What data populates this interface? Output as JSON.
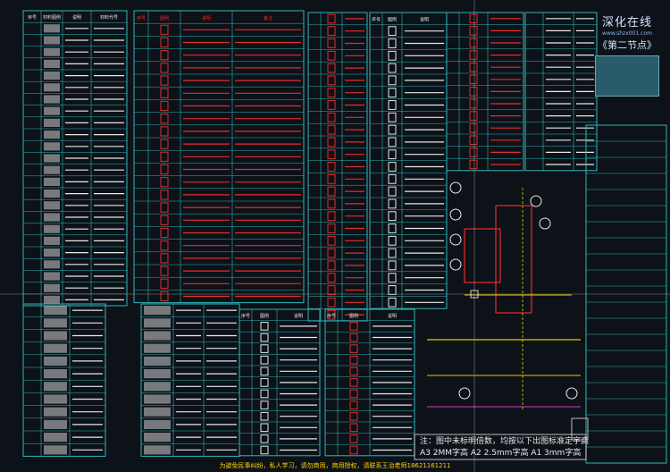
{
  "watermark": {
    "title": "深化在线",
    "url": "www.shzx001.com",
    "subtitle": "《第二节点》"
  },
  "note": {
    "line1": "注：图中未标明倍数，均按以下出图标准定字高",
    "line2": "A3 2MM字高  A2 2.5mm字高  A1 3mm字高"
  },
  "footer": {
    "text": "为避免民事纠纷，私人学习，请勿商用，商用授权，请联系王治老师18621161211"
  },
  "legend_a": {
    "headers": [
      "序号",
      "材料图例",
      "说明",
      "材料代号"
    ]
  },
  "legend_b": {
    "headers": [
      "序号",
      "图例",
      "说明",
      "备注"
    ]
  },
  "legend_c": {
    "headers": [
      "序号",
      "图例",
      "说明"
    ]
  },
  "colors": {
    "table_line": "#2fb8b8",
    "cad_red": "#e52d2d",
    "cad_yellow": "#e0d000",
    "cad_green": "#3ccf3c",
    "cad_white": "#e8e8e8",
    "cad_magenta": "#d43ad4"
  }
}
